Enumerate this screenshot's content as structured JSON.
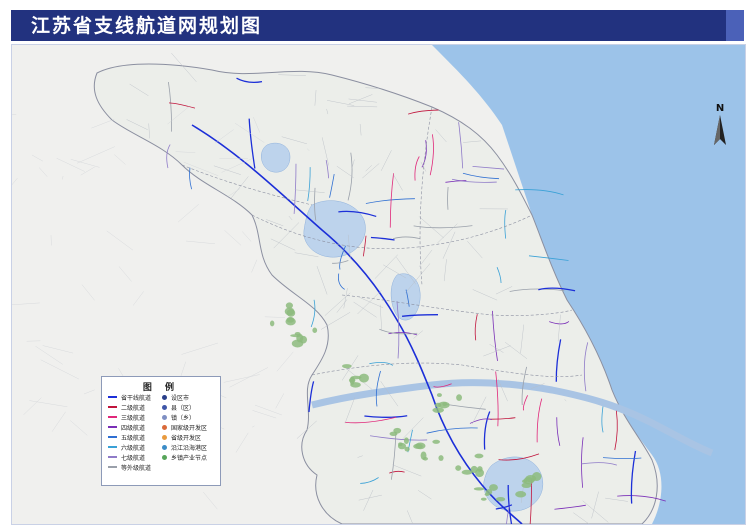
{
  "title": "江苏省支线航道网规划图",
  "compass": {
    "label": "N",
    "icon": "north-arrow-icon"
  },
  "legend": {
    "title": "图  例",
    "lines": [
      {
        "label": "省干线航道",
        "color": "#1c2fd8"
      },
      {
        "label": "二级航道",
        "color": "#c0143c"
      },
      {
        "label": "三级航道",
        "color": "#e0287a"
      },
      {
        "label": "四级航道",
        "color": "#7a2fb7"
      },
      {
        "label": "五级航道",
        "color": "#2f6fd2"
      },
      {
        "label": "六级航道",
        "color": "#3aa1d6"
      },
      {
        "label": "七级航道",
        "color": "#8f7bc8"
      },
      {
        "label": "等外级航道",
        "color": "#9aa0aa"
      }
    ],
    "symbols": [
      {
        "label": "设区市",
        "color": "#2a3f8a",
        "icon": "city-dot-icon"
      },
      {
        "label": "县（区）",
        "color": "#3f56a8",
        "icon": "county-dot-icon"
      },
      {
        "label": "镇（乡）",
        "color": "#7f8fc3",
        "icon": "town-dot-icon"
      },
      {
        "label": "国家级开发区",
        "color": "#d96a3a",
        "icon": "national-zone-icon"
      },
      {
        "label": "省级开发区",
        "color": "#e89a3f",
        "icon": "provincial-zone-icon"
      },
      {
        "label": "沿江沿海港区",
        "color": "#3c8cc7",
        "icon": "port-zone-icon"
      },
      {
        "label": "乡镇产业节点",
        "color": "#57a55a",
        "icon": "industry-node-icon"
      }
    ]
  },
  "colors": {
    "sea": "#9cc3e9",
    "land": "#eceeea",
    "outside": "#f0f0ee",
    "lake": "#bdd3ec",
    "river": "#a9c4e4",
    "mountain": "#8dbb7e",
    "trunk": "#1c2fd8",
    "road": "#b8bcc4",
    "boundary": "#8b8fa0",
    "title_bg": "#22327f"
  }
}
